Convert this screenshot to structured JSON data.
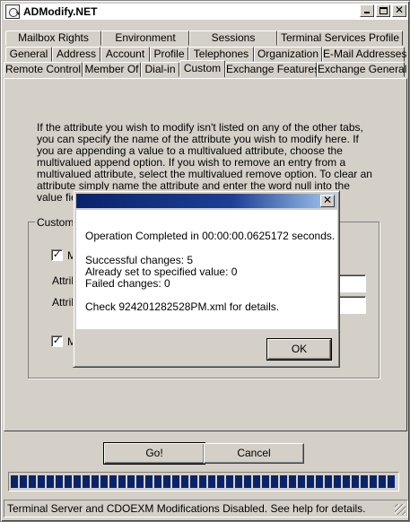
{
  "window": {
    "title": "ADModify.NET"
  },
  "tabs": {
    "row1": [
      "Mailbox Rights",
      "Environment",
      "Sessions",
      "Terminal Services Profile"
    ],
    "row2": [
      "General",
      "Address",
      "Account",
      "Profile",
      "Telephones",
      "Organization",
      "E-Mail Addresses"
    ],
    "row3": [
      "Remote Control",
      "Member Of",
      "Dial-in",
      "Custom",
      "Exchange Features",
      "Exchange General"
    ],
    "active": "Custom"
  },
  "custom_tab": {
    "description": "If the attribute you wish to modify isn't listed on any of the other tabs, you can specify the name of the attribute you wish to modify here.  If you are appending a value to a multivalued attribute, choose the multivalued append option.  If you wish to remove an entry from a multivalued attribute, select the multivalued remove option.  To clear an attribute simply name the attribute and enter the word null into the value field.  Refer to the ADModify help for",
    "group_label": "Custom",
    "checkbox1_label": "M",
    "checkbox1_checked": true,
    "attr_label1": "Attrib",
    "attr_label2": "Attrib",
    "checkbox2_label": "M",
    "checkbox2_checked": true
  },
  "dialog": {
    "line1": "Operation Completed in 00:00:00.0625172 seconds.",
    "line2": "Successful changes: 5",
    "line3": "Already set to specified value: 0",
    "line4": "Failed changes: 0",
    "line5": "Check 924201282528PM.xml for details.",
    "ok_label": "OK",
    "close_glyph": "✕"
  },
  "buttons": {
    "go": "Go!",
    "cancel": "Cancel"
  },
  "progress": {
    "fraction": 1.0,
    "color": "#0a246a"
  },
  "status": {
    "text": "Terminal Server and CDOEXM Modifications Disabled.  See help for details."
  },
  "icons": {
    "check": "✓",
    "close": "✕"
  }
}
